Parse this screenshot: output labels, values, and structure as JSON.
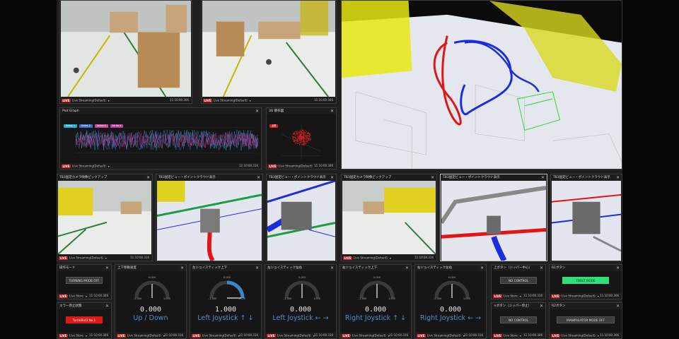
{
  "cameras_top": [
    {
      "title": "",
      "source": "Live Streaming(Default)",
      "time": "11:10:00.306"
    },
    {
      "title": "",
      "source": "Live Streaming(Default)",
      "time": "11:10:00.306"
    }
  ],
  "plot_panel": {
    "title": "Plot Graph",
    "legend": [
      "Series 1",
      "Series 2",
      "Series 3",
      "Series 4"
    ],
    "legend_colors": [
      "#2aa9c9",
      "#3f6fd0",
      "#d04aa0",
      "#c03aa8"
    ],
    "source": "Live Streaming(Default)",
    "time": "11:10:00.316"
  },
  "scatter_panel": {
    "title": "3D 散布図",
    "legend": "点群",
    "source": "Live Streaming(Default)",
    "time": "11:10:00.306"
  },
  "cameras_mid": [
    {
      "title": "TB3固定カメラ映像ピックアップ",
      "source": "Live Streaming(Default)",
      "time": "11:10:00.316"
    },
    {
      "title": "TB3固定ビュー・ポイントクラウド表示",
      "source": "",
      "time": ""
    },
    {
      "title": "TB3固定ビュー・ポイントクラウド表示",
      "source": "",
      "time": ""
    },
    {
      "title": "TB3固定カメラ映像ピックアップ",
      "source": "Live Streaming(Default)",
      "time": "11:10:00.316"
    },
    {
      "title": "TB3固定ビュー・ポイントクラウド表示",
      "source": "",
      "time": ""
    },
    {
      "title": "TB3固定ビュー・ポイントクラウド表示",
      "source": "",
      "time": ""
    }
  ],
  "live_label": "LIVE",
  "close_glyph": "✕",
  "dropdown_glyph": "▾",
  "mode_panels": [
    {
      "title": "操作モード",
      "button": "TURNING MODE OFF",
      "style": "gray",
      "source": "Live Store",
      "time": "11:10:00.306"
    },
    {
      "title": "エラー停止状態",
      "button": "TurtleBot3 No.1",
      "style": "red",
      "source": "Live Store",
      "time": "11:10:00.306"
    }
  ],
  "gauges": [
    {
      "title": "上下移動速度",
      "value": "0.000",
      "label": "Up / Down",
      "level": 0.5,
      "source": "Live Streaming(Default)",
      "time": "11:10:00.316"
    },
    {
      "title": "左ジョイスティック上下",
      "value": "1.000",
      "label": "Left Joystick ↑ ↓",
      "level": 1.0,
      "source": "Live Streaming(Default)",
      "time": "11:10:00.316"
    },
    {
      "title": "左ジョイスティック左右",
      "value": "0.000",
      "label": "Left Joystick ← →",
      "level": 0.5,
      "source": "Live Streaming(Default)",
      "time": "11:10:00.316"
    },
    {
      "title": "右ジョイスティック上下",
      "value": "0.000",
      "label": "Right Joystick ↑ ↓",
      "level": 0.5,
      "source": "Live Streaming(Default)",
      "time": "11:10:00.316"
    },
    {
      "title": "右ジョイスティック左右",
      "value": "0.000",
      "label": "Right Joystick ← →",
      "level": 0.5,
      "source": "Live Streaming(Default)",
      "time": "11:10:00.316"
    }
  ],
  "gauge_scale": {
    "min": "-1.000",
    "mid": "0.000",
    "max": "1.000"
  },
  "control_panels": [
    {
      "title": "上ボタン（ジッパー中心）",
      "button": "NO CONTROL",
      "style": "gray",
      "source": "Live Store",
      "time": "11:10:00.316"
    },
    {
      "title": "×ボタン（ジッパー停止）",
      "button": "NO CONTROL",
      "style": "gray",
      "source": "Live Store",
      "time": "11:10:00.306"
    }
  ],
  "right_panels": [
    {
      "title": "R1ボタン",
      "button": "TWIST MODE",
      "style": "green",
      "source": "Live Streaming(Default)",
      "time": "11:10:00.306"
    },
    {
      "title": "R2ボタン",
      "button": "MANIPULATOR MODE OFF",
      "style": "gray",
      "source": "Live Streaming(Default)",
      "time": "11:10:00.306"
    }
  ]
}
